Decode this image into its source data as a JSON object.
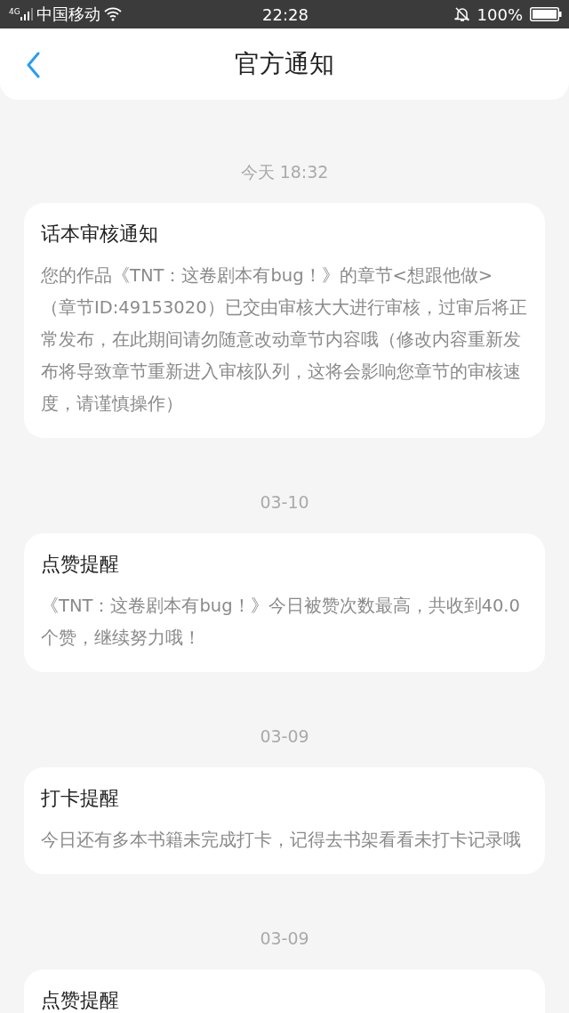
{
  "status_bar": {
    "network": "4G",
    "carrier": "中国移动",
    "time": "22:28",
    "battery": "100%"
  },
  "header": {
    "title": "官方通知"
  },
  "notifications": [
    {
      "date": "今天 18:32",
      "title": "话本审核通知",
      "body": "您的作品《TNT：这卷剧本有bug！》的章节<想跟他做>（章节ID:49153020）已交由审核大大进行审核，过审后将正常发布，在此期间请勿随意改动章节内容哦（修改内容重新发布将导致章节重新进入审核队列，这将会影响您章节的审核速度，请谨慎操作）"
    },
    {
      "date": "03-10",
      "title": "点赞提醒",
      "body": "《TNT：这卷剧本有bug！》今日被赞次数最高，共收到40.0个赞，继续努力哦！"
    },
    {
      "date": "03-09",
      "title": "打卡提醒",
      "body": "今日还有多本书籍未完成打卡，记得去书架看看未打卡记录哦"
    },
    {
      "date": "03-09",
      "title": "点赞提醒"
    }
  ]
}
